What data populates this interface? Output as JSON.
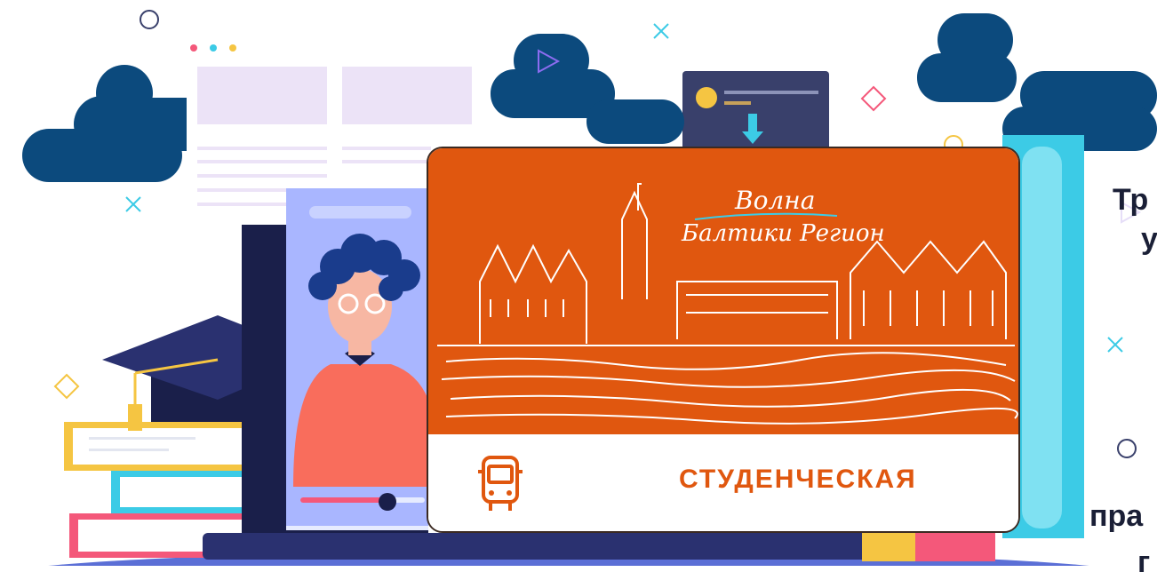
{
  "right_text": {
    "line1": "Тр",
    "line2": "у",
    "line3": "пра",
    "line4": "г"
  },
  "card": {
    "logo_line1": "Волна",
    "logo_line2": "Балтики Регион",
    "label": "СТУДЕНЧЕСКАЯ",
    "colors": {
      "orange": "#e0570f",
      "label": "#e0570f",
      "border": "#3b2a22"
    }
  },
  "icons": {
    "bus": "bus-icon",
    "graduation_cap": "graduation-cap-icon",
    "download_arrow": "download-arrow-icon",
    "play": "play-icon"
  }
}
